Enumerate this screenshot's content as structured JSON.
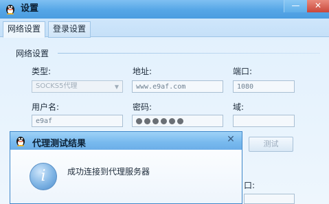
{
  "window": {
    "title": "设置",
    "minimize_glyph": "—",
    "close_glyph": "✕"
  },
  "tabs": [
    {
      "label": "网络设置",
      "active": true
    },
    {
      "label": "登录设置",
      "active": false
    }
  ],
  "group": {
    "label": "网络设置"
  },
  "fields": {
    "type_label": "类型:",
    "type_value": "SOCKS5代理",
    "address_label": "地址:",
    "address_value": "www.e9af.com",
    "port_label": "端口:",
    "port_value": "1080",
    "username_label": "用户名:",
    "username_value": "e9af",
    "password_label": "密码:",
    "domain_label": "域:",
    "domain_value": "",
    "partial_label_behind_dialog": "口:"
  },
  "buttons": {
    "test_label": "测试"
  },
  "dialog": {
    "title": "代理测试结果",
    "close_glyph": "✕",
    "message": "成功连接到代理服务器",
    "info_glyph": "i"
  },
  "colors": {
    "title_bar": "#55a6e6",
    "close_button": "#c9473a",
    "dialog_border": "#3d86c9"
  },
  "icons": [
    "qq-penguin-icon",
    "info-icon",
    "dropdown-arrow-icon",
    "close-icon"
  ]
}
